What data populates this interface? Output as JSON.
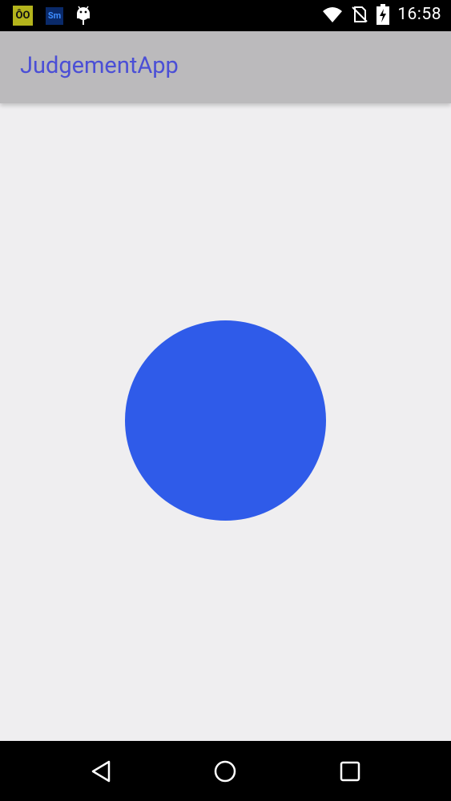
{
  "status_bar": {
    "notifications": [
      "oo-app-icon",
      "sm-app-icon",
      "android-debug-icon"
    ],
    "oo_label": "ÔO",
    "sm_label": "Sm",
    "icons": [
      "wifi-icon",
      "no-sim-icon",
      "battery-charging-icon"
    ],
    "time": "16:58"
  },
  "app_bar": {
    "title": "JudgementApp",
    "background": "#bbbabc",
    "title_color": "#4b4fd6"
  },
  "content": {
    "background": "#efeef0",
    "circle_color": "#2f5be9"
  },
  "nav_bar": {
    "buttons": [
      "back-icon",
      "home-icon",
      "recents-icon"
    ]
  }
}
